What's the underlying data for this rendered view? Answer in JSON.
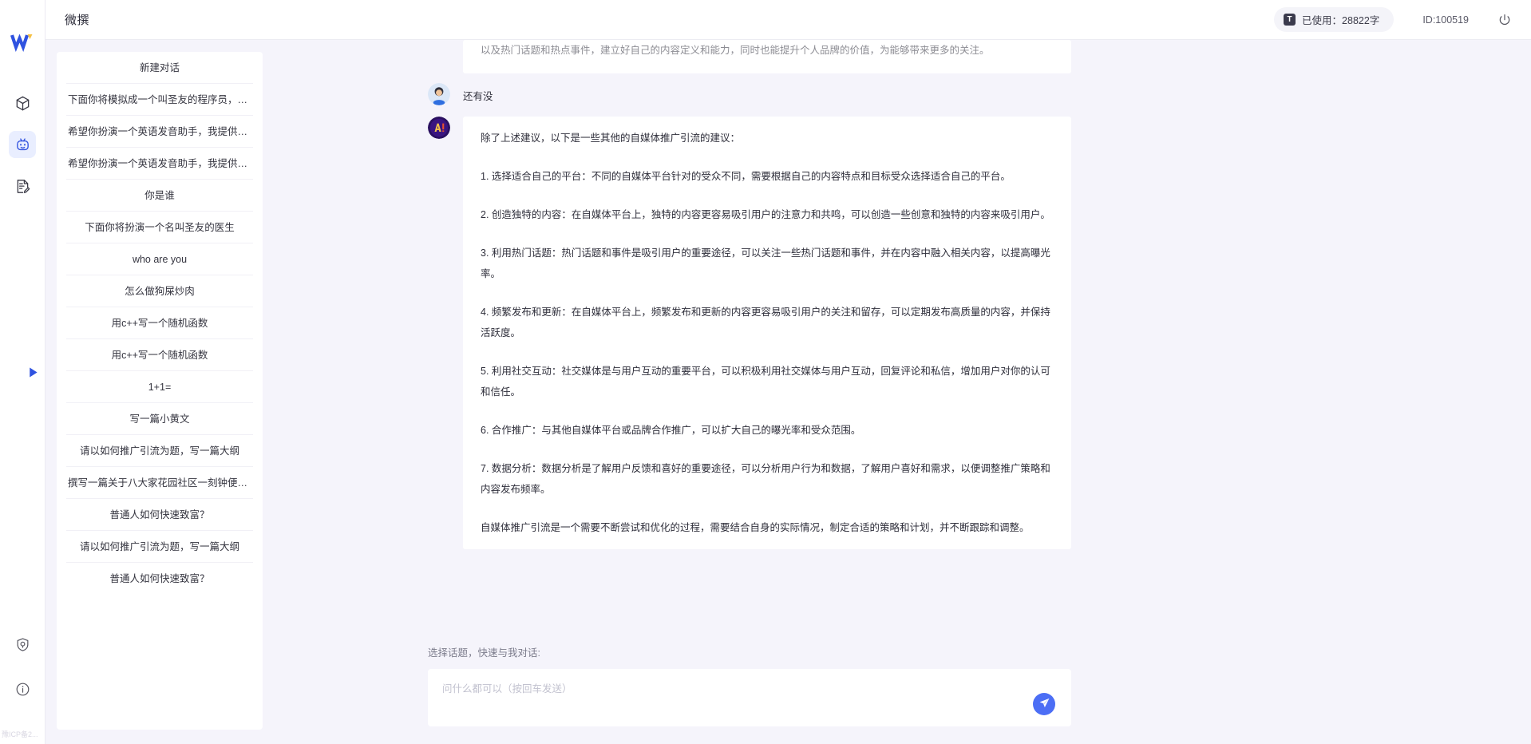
{
  "app": {
    "title": "微撰",
    "brand_color": "#4c6ef5",
    "background_color": "#f5f4fb",
    "panel_color": "#ffffff"
  },
  "rail": {
    "logo_icon": "w-logo-icon",
    "items": [
      {
        "icon": "cube-icon",
        "active": false
      },
      {
        "icon": "robot-icon",
        "active": true
      },
      {
        "icon": "document-edit-icon",
        "active": false
      }
    ],
    "bottom_items": [
      {
        "icon": "shield-icon"
      },
      {
        "icon": "info-icon"
      }
    ],
    "collapse_icon": "play-triangle-icon",
    "footer_text": "豫ICP备2..."
  },
  "header": {
    "title": "微撰",
    "usage": {
      "badge": "T",
      "label": "已使用：28822字"
    },
    "user_id": "ID:100519",
    "power_icon": "power-icon"
  },
  "conversations": {
    "new_chat_label": "新建对话",
    "items": [
      "下面你将模拟成一个叫圣友的程序员，我说...",
      "希望你扮演一个英语发音助手，我提供给你...",
      "希望你扮演一个英语发音助手，我提供给你...",
      "你是谁",
      "下面你将扮演一个名叫圣友的医生",
      "who are you",
      "怎么做狗屎炒肉",
      "用c++写一个随机函数",
      "用c++写一个随机函数",
      "1+1=",
      "写一篇小黄文",
      "请以如何推广引流为题，写一篇大纲",
      "撰写一篇关于八大家花园社区一刻钟便民生...",
      "普通人如何快速致富？",
      "请以如何推广引流为题，写一篇大纲",
      "普通人如何快速致富？"
    ]
  },
  "chat": {
    "messages": [
      {
        "role": "assistant",
        "avatar_icon": "ai-avatar-icon",
        "clipped": true,
        "paragraphs": [
          "以及热门话题和热点事件，建立好自己的内容定义和能力，同时也能提升个人品牌的价值，为能够带来更多的关注。"
        ]
      },
      {
        "role": "user",
        "avatar_icon": "user-avatar-icon",
        "paragraphs": [
          "还有没"
        ]
      },
      {
        "role": "assistant",
        "avatar_icon": "ai-avatar-icon",
        "paragraphs": [
          "除了上述建议，以下是一些其他的自媒体推广引流的建议：",
          "1. 选择适合自己的平台：不同的自媒体平台针对的受众不同，需要根据自己的内容特点和目标受众选择适合自己的平台。",
          "2. 创造独特的内容：在自媒体平台上，独特的内容更容易吸引用户的注意力和共鸣，可以创造一些创意和独特的内容来吸引用户。",
          "3. 利用热门话题：热门话题和事件是吸引用户的重要途径，可以关注一些热门话题和事件，并在内容中融入相关内容，以提高曝光率。",
          "4. 频繁发布和更新：在自媒体平台上，频繁发布和更新的内容更容易吸引用户的关注和留存，可以定期发布高质量的内容，并保持活跃度。",
          "5. 利用社交互动：社交媒体是与用户互动的重要平台，可以积极利用社交媒体与用户互动，回复评论和私信，增加用户对你的认可和信任。",
          "6. 合作推广：与其他自媒体平台或品牌合作推广，可以扩大自己的曝光率和受众范围。",
          "7. 数据分析：数据分析是了解用户反馈和喜好的重要途径，可以分析用户行为和数据，了解用户喜好和需求，以便调整推广策略和内容发布频率。",
          "自媒体推广引流是一个需要不断尝试和优化的过程，需要结合自身的实际情况，制定合适的策略和计划，并不断跟踪和调整。"
        ]
      }
    ]
  },
  "composer": {
    "label": "选择话题，快速与我对话:",
    "placeholder": "问什么都可以（按回车发送）",
    "value": "",
    "send_icon": "send-paper-plane-icon"
  }
}
